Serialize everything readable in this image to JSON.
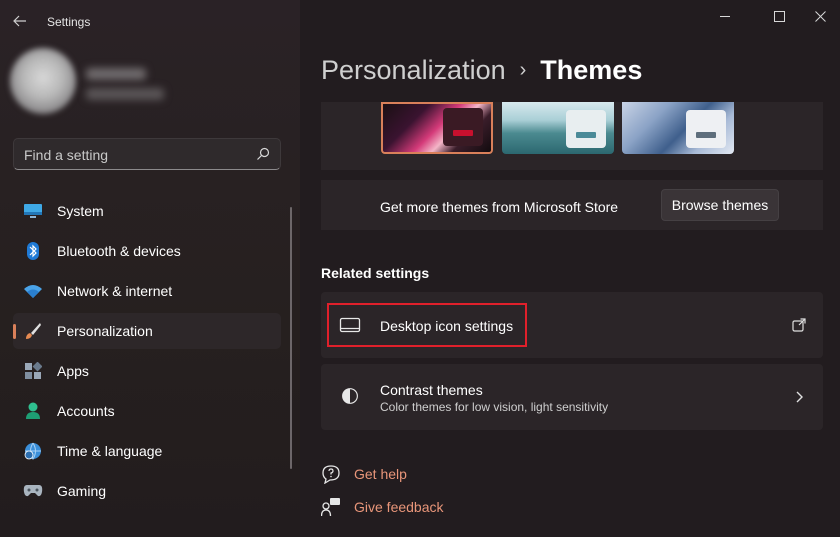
{
  "window": {
    "title": "Settings",
    "back_icon": "back-arrow-icon",
    "controls": [
      "minimize",
      "maximize",
      "close"
    ]
  },
  "sidebar": {
    "search": {
      "placeholder": "Find a setting",
      "icon": "search-icon"
    },
    "items": [
      {
        "label": "System",
        "icon": "monitor-icon",
        "active": false
      },
      {
        "label": "Bluetooth & devices",
        "icon": "bluetooth-icon",
        "active": false
      },
      {
        "label": "Network & internet",
        "icon": "wifi-icon",
        "active": false
      },
      {
        "label": "Personalization",
        "icon": "brush-icon",
        "active": true
      },
      {
        "label": "Apps",
        "icon": "apps-icon",
        "active": false
      },
      {
        "label": "Accounts",
        "icon": "person-icon",
        "active": false
      },
      {
        "label": "Time & language",
        "icon": "globe-clock-icon",
        "active": false
      },
      {
        "label": "Gaming",
        "icon": "gamepad-icon",
        "active": false
      }
    ]
  },
  "header": {
    "parent": "Personalization",
    "separator": "›",
    "current": "Themes"
  },
  "themes": {
    "thumbnails": [
      "theme-1",
      "theme-2",
      "theme-3"
    ],
    "store_text": "Get more themes from Microsoft Store",
    "browse_label": "Browse themes"
  },
  "related": {
    "title": "Related settings",
    "desktop_icon": {
      "title": "Desktop icon settings",
      "trail_icon": "open-external-icon"
    },
    "contrast": {
      "title": "Contrast themes",
      "subtitle": "Color themes for low vision, light sensitivity",
      "trail_icon": "chevron-right-icon"
    }
  },
  "help": {
    "get_help": "Get help",
    "give_feedback": "Give feedback"
  },
  "colors": {
    "accent": "#d9805a",
    "link": "#e9967a",
    "highlight_box": "#e0202b",
    "background": "#231d20",
    "card": "#2b2528"
  }
}
